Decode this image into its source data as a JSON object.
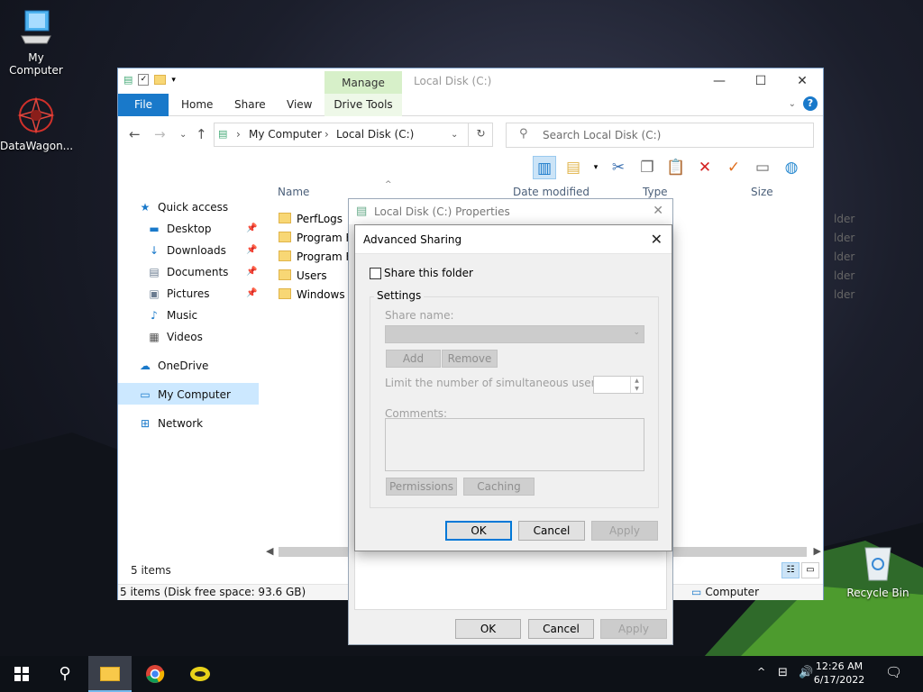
{
  "desktop": {
    "icons": [
      {
        "label": "My Computer",
        "icon": "computer-icon"
      },
      {
        "label": "DataWagon...",
        "icon": "datawagon-icon"
      },
      {
        "label": "Recycle Bin",
        "icon": "recycle-bin-icon"
      }
    ]
  },
  "explorer": {
    "title": "Local Disk (C:)",
    "manage_tab": "Manage",
    "ribbon_tabs": [
      "File",
      "Home",
      "Share",
      "View",
      "Drive Tools"
    ],
    "address": {
      "parts": [
        "My Computer",
        "Local Disk (C:)"
      ]
    },
    "search": {
      "placeholder": "Search Local Disk (C:)"
    },
    "sidebar": {
      "quick_access": "Quick access",
      "pinned": [
        "Desktop",
        "Downloads",
        "Documents",
        "Pictures"
      ],
      "unpinned": [
        "Music",
        "Videos"
      ],
      "onedrive": "OneDrive",
      "my_computer": "My Computer",
      "network": "Network"
    },
    "columns": {
      "name": "Name",
      "date": "Date modified",
      "type": "Type",
      "size": "Size"
    },
    "files": [
      {
        "name": "PerfLogs",
        "type": "lder"
      },
      {
        "name": "Program Fi",
        "type": "lder"
      },
      {
        "name": "Program Fi",
        "type": "lder"
      },
      {
        "name": "Users",
        "type": "lder"
      },
      {
        "name": "Windows",
        "type": "lder"
      }
    ],
    "item_count": "5 items",
    "status_left": "5 items (Disk free space: 93.6 GB)",
    "status_right": "Computer"
  },
  "properties": {
    "title": "Local Disk (C:) Properties",
    "ok": "OK",
    "cancel": "Cancel",
    "apply": "Apply"
  },
  "advanced_sharing": {
    "title": "Advanced Sharing",
    "share_checkbox": "Share this folder",
    "share_checked": false,
    "settings_label": "Settings",
    "share_name_label": "Share name:",
    "add": "Add",
    "remove": "Remove",
    "limit_label": "Limit the number of simultaneous users to:",
    "comments_label": "Comments:",
    "permissions": "Permissions",
    "caching": "Caching",
    "ok": "OK",
    "cancel": "Cancel",
    "apply": "Apply"
  },
  "taskbar": {
    "time": "12:26 AM",
    "date": "6/17/2022"
  }
}
